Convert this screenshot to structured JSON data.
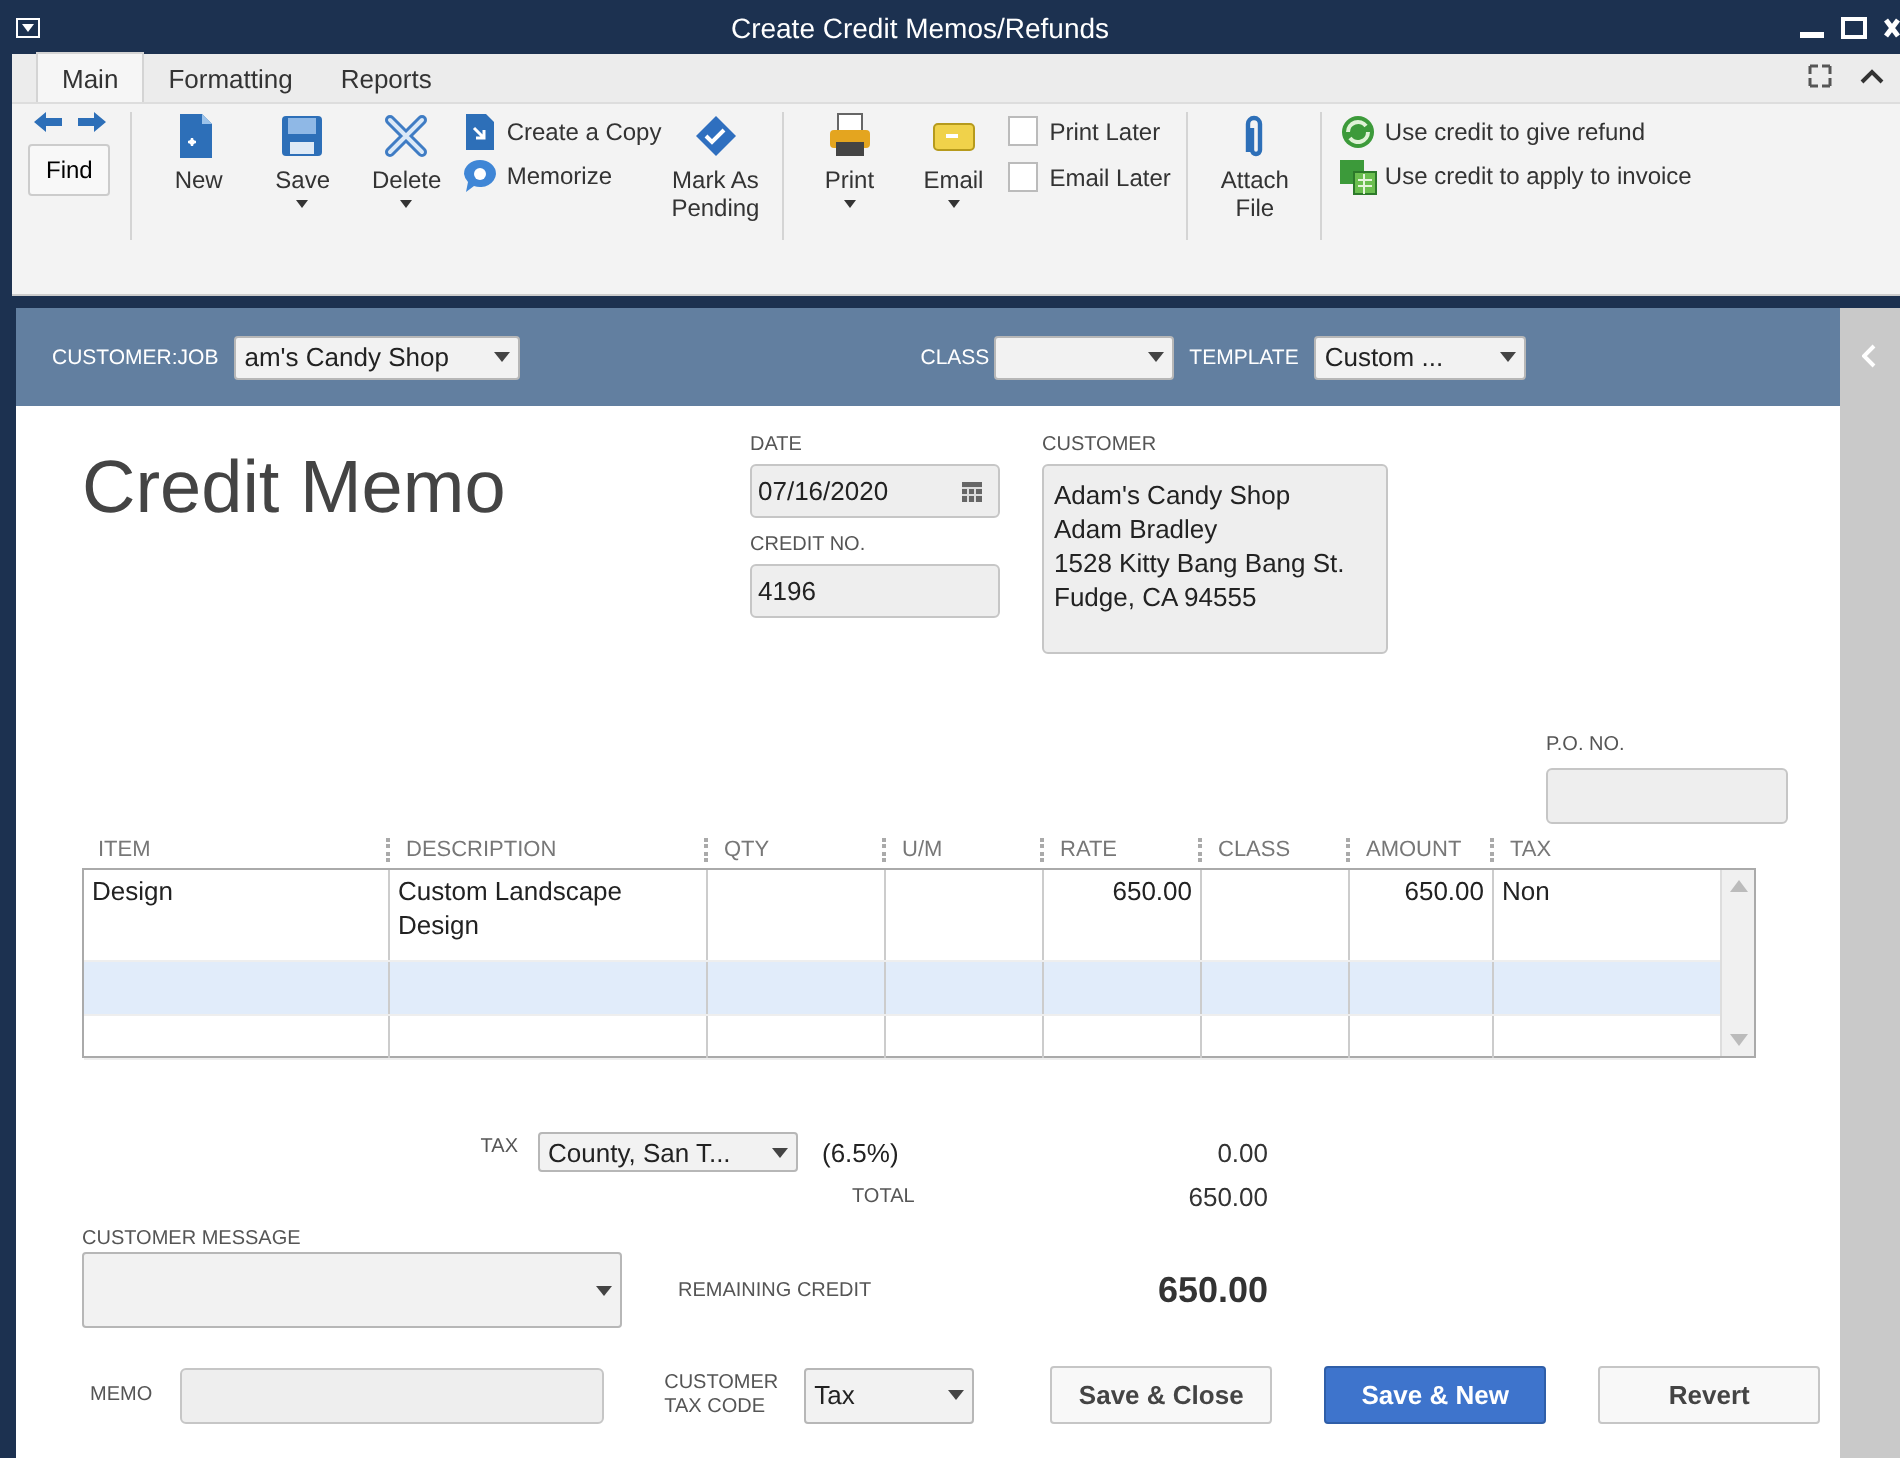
{
  "window": {
    "title": "Create Credit Memos/Refunds"
  },
  "tabs": [
    {
      "label": "Main",
      "selected": true
    },
    {
      "label": "Formatting",
      "selected": false
    },
    {
      "label": "Reports",
      "selected": false
    }
  ],
  "toolbar": {
    "find": "Find",
    "groups": [
      [
        {
          "kind": "big",
          "label": "New",
          "menu": false
        },
        {
          "kind": "big",
          "label": "Save",
          "menu": true
        },
        {
          "kind": "big",
          "label": "Delete",
          "menu": true
        },
        {
          "kind": "stack",
          "items": [
            {
              "label": "Create a Copy"
            },
            {
              "label": "Memorize"
            }
          ]
        },
        {
          "kind": "big",
          "label": "Mark As Pending",
          "menu": false
        }
      ],
      [
        {
          "kind": "big",
          "label": "Print",
          "menu": true
        },
        {
          "kind": "big",
          "label": "Email",
          "menu": true
        },
        {
          "kind": "checks",
          "items": [
            {
              "label": "Print Later",
              "checked": false
            },
            {
              "label": "Email Later",
              "checked": false
            }
          ]
        }
      ],
      [
        {
          "kind": "big",
          "label": "Attach File",
          "menu": false
        }
      ],
      [
        {
          "kind": "stack",
          "items": [
            {
              "label": "Use credit to give refund"
            },
            {
              "label": "Use credit to apply to invoice"
            }
          ]
        }
      ]
    ]
  },
  "header": {
    "customer_job": {
      "label": "CUSTOMER:JOB",
      "value": "am's Candy Shop"
    },
    "class": {
      "label": "CLASS"
    },
    "template": {
      "label": "TEMPLATE",
      "value": "Custom ..."
    }
  },
  "form": {
    "title": "Credit Memo",
    "date": {
      "label": "DATE",
      "value": "07/16/2020"
    },
    "credit_no": {
      "label": "CREDIT NO.",
      "value": "4196"
    },
    "customer": {
      "label": "CUSTOMER",
      "lines": [
        "Adam's Candy Shop",
        "Adam Bradley",
        "1528 Kitty Bang Bang St.",
        "Fudge, CA 94555"
      ]
    },
    "po_no": {
      "label": "P.O. NO."
    }
  },
  "table": {
    "columns": [
      "ITEM",
      "DESCRIPTION",
      "QTY",
      "U/M",
      "RATE",
      "CLASS",
      "AMOUNT",
      "TAX"
    ],
    "rows": [
      {
        "cells": [
          "Design",
          "Custom Landscape Design",
          "",
          "",
          "650.00",
          "",
          "650.00",
          "Non"
        ],
        "selected": false
      },
      {
        "cells": [
          "",
          "",
          "",
          "",
          "",
          "",
          "",
          ""
        ],
        "selected": true
      },
      {
        "cells": [
          "",
          "",
          "",
          "",
          "",
          "",
          "",
          ""
        ],
        "selected": false
      }
    ]
  },
  "totals": {
    "tax_label": "TAX",
    "tax_item": "County, San T...",
    "tax_rate": "(6.5%)",
    "tax_amount": "0.00",
    "total_label": "TOTAL",
    "total": "650.00",
    "remaining_label": "REMAINING CREDIT",
    "remaining": "650.00"
  },
  "footer": {
    "message_label": "CUSTOMER MESSAGE",
    "memo_label": "MEMO",
    "tax_code_label": "CUSTOMER TAX CODE",
    "tax_code": "Tax",
    "buttons": [
      {
        "label": "Save & Close",
        "primary": false
      },
      {
        "label": "Save & New",
        "primary": true
      },
      {
        "label": "Revert",
        "primary": false
      }
    ]
  }
}
